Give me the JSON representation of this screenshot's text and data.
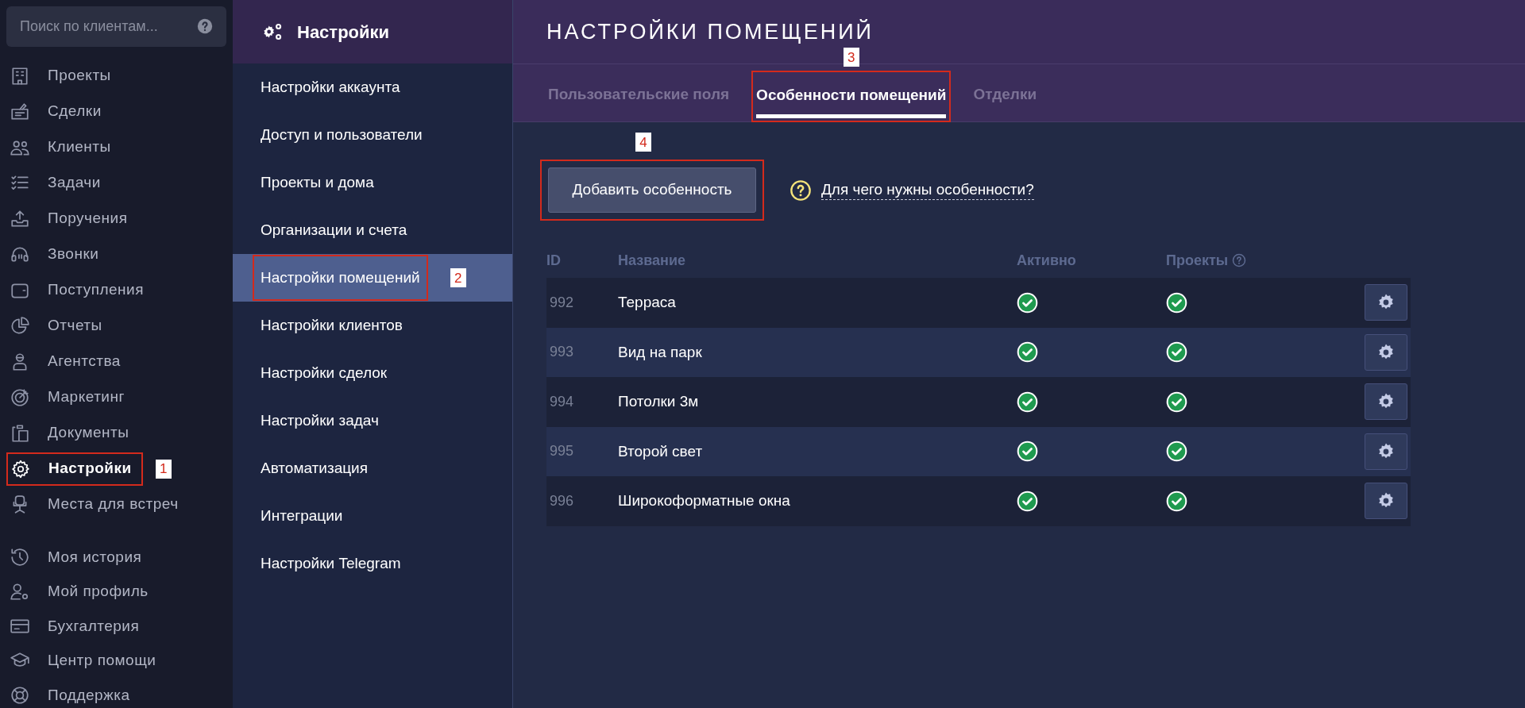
{
  "search": {
    "placeholder": "Поиск по клиентам..."
  },
  "nav_items": [
    {
      "label": "Проекты",
      "selected": false
    },
    {
      "label": "Сделки",
      "selected": false
    },
    {
      "label": "Клиенты",
      "selected": false
    },
    {
      "label": "Задачи",
      "selected": false
    },
    {
      "label": "Поручения",
      "selected": false
    },
    {
      "label": "Звонки",
      "selected": false
    },
    {
      "label": "Поступления",
      "selected": false
    },
    {
      "label": "Отчеты",
      "selected": false
    },
    {
      "label": "Агентства",
      "selected": false
    },
    {
      "label": "Маркетинг",
      "selected": false
    },
    {
      "label": "Документы",
      "selected": false
    },
    {
      "label": "Настройки",
      "selected": true,
      "callout": "1"
    },
    {
      "label": "Места для встреч",
      "selected": false
    }
  ],
  "bottom_items": [
    {
      "label": "Моя история"
    },
    {
      "label": "Мой профиль"
    },
    {
      "label": "Бухгалтерия"
    },
    {
      "label": "Центр помощи"
    },
    {
      "label": "Поддержка"
    }
  ],
  "settings_menu": {
    "title": "Настройки",
    "items": [
      {
        "label": "Настройки аккаунта",
        "selected": false
      },
      {
        "label": "Доступ и пользователи",
        "selected": false
      },
      {
        "label": "Проекты и дома",
        "selected": false
      },
      {
        "label": "Организации и счета",
        "selected": false
      },
      {
        "label": "Настройки помещений",
        "selected": true,
        "callout": "2"
      },
      {
        "label": "Настройки клиентов",
        "selected": false
      },
      {
        "label": "Настройки сделок",
        "selected": false
      },
      {
        "label": "Настройки задач",
        "selected": false
      },
      {
        "label": "Автоматизация",
        "selected": false
      },
      {
        "label": "Интеграции",
        "selected": false
      },
      {
        "label": "Настройки Telegram",
        "selected": false
      }
    ]
  },
  "page_title": "НАСТРОЙКИ ПОМЕЩЕНИЙ",
  "tabs": [
    {
      "label": "Пользовательские поля",
      "selected": false
    },
    {
      "label": "Особенности помещений",
      "selected": true,
      "callout": "3"
    },
    {
      "label": "Отделки",
      "selected": false
    }
  ],
  "add_button": {
    "label": "Добавить особенность",
    "callout": "4"
  },
  "help_link": "Для чего нужны особенности?",
  "table": {
    "columns": [
      "ID",
      "Название",
      "Активно",
      "Проекты"
    ],
    "rows": [
      {
        "id": "992",
        "name": "Терраса",
        "active": true,
        "projects": true
      },
      {
        "id": "993",
        "name": "Вид на парк",
        "active": true,
        "projects": true
      },
      {
        "id": "994",
        "name": "Потолки 3м",
        "active": true,
        "projects": true
      },
      {
        "id": "995",
        "name": "Второй свет",
        "active": true,
        "projects": true
      },
      {
        "id": "996",
        "name": "Широкоформатные окна",
        "active": true,
        "projects": true
      }
    ]
  }
}
